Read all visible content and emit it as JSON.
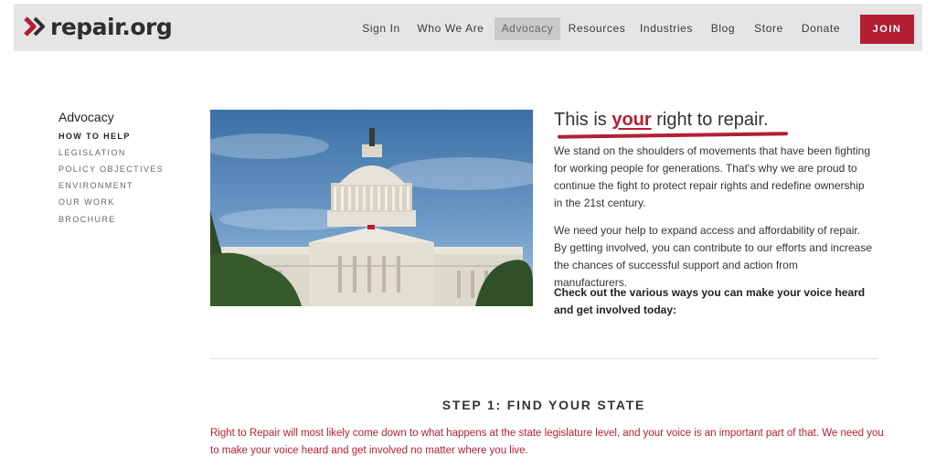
{
  "header": {
    "logo_text": "repair.org",
    "nav": [
      {
        "label": "Sign In"
      },
      {
        "label": "Who We Are"
      },
      {
        "label": "Advocacy"
      },
      {
        "label": "Resources"
      },
      {
        "label": "Industries"
      },
      {
        "label": "Blog"
      },
      {
        "label": "Store"
      },
      {
        "label": "Donate"
      }
    ],
    "join_label": "JOIN"
  },
  "sidebar": {
    "title": "Advocacy",
    "items": [
      {
        "label": "HOW TO HELP"
      },
      {
        "label": "LEGISLATION"
      },
      {
        "label": "POLICY OBJECTIVES"
      },
      {
        "label": "ENVIRONMENT"
      },
      {
        "label": "OUR WORK"
      },
      {
        "label": "BROCHURE"
      }
    ]
  },
  "hero": {
    "heading_before": "This is ",
    "heading_emphasis": "your",
    "heading_after": " right to repair.",
    "paragraphs": [
      "We stand on the shoulders of movements that have been fighting for working people for generations. That's why we are proud to continue the fight to protect repair rights and redefine ownership in the 21st century.",
      "We need your help to expand access and affordability of repair. By getting involved, you can contribute to our efforts and increase the chances of successful support and action from manufacturers.",
      "Check out the various ways you can make your voice heard and get involved today:"
    ]
  },
  "step": {
    "title": "STEP 1: FIND YOUR STATE",
    "body": "Right to Repair will most likely come down to what happens at the state legislature level, and your voice is an important part of that. We need you to make your voice heard and get involved no matter where you live."
  },
  "colors": {
    "brand_red": "#b31f32",
    "nav_background": "#e5e5e5",
    "nav_active": "#c9c9c9"
  }
}
